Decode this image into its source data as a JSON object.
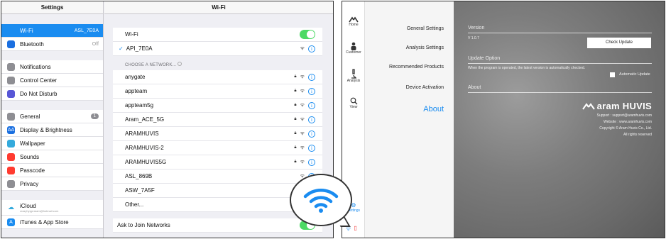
{
  "ipad": {
    "settings_title": "Settings",
    "wifi_title": "Wi-Fi",
    "settings_rows": [
      {
        "label": "Wi-Fi",
        "value": "ASL_7E0A",
        "icon": "wifi-icon",
        "color": "#1a8cf0",
        "selected": true
      },
      {
        "label": "Bluetooth",
        "value": "Off",
        "icon": "bluetooth-icon",
        "color": "#1a6fe0"
      }
    ],
    "settings_group2": [
      {
        "label": "Notifications",
        "icon": "notifications-icon",
        "color": "#8e8e93"
      },
      {
        "label": "Control Center",
        "icon": "control-center-icon",
        "color": "#8e8e93"
      },
      {
        "label": "Do Not Disturb",
        "icon": "moon-icon",
        "color": "#5856d6"
      }
    ],
    "settings_group3": [
      {
        "label": "General",
        "icon": "gear-icon",
        "color": "#8e8e93",
        "badge": "1"
      },
      {
        "label": "Display & Brightness",
        "icon": "display-icon",
        "color": "#1a6fe0",
        "glyph": "AA"
      },
      {
        "label": "Wallpaper",
        "icon": "wallpaper-icon",
        "color": "#34aadc"
      },
      {
        "label": "Sounds",
        "icon": "sounds-icon",
        "color": "#ff3b30"
      },
      {
        "label": "Passcode",
        "icon": "lock-icon",
        "color": "#ff3b30"
      },
      {
        "label": "Privacy",
        "icon": "hand-icon",
        "color": "#8e8e93"
      }
    ],
    "icloud": {
      "label": "iCloud",
      "sub": "crazyhyppraram@hotmail.com"
    },
    "itunes": {
      "label": "iTunes & App Store"
    },
    "wifi_label": "Wi-Fi",
    "connected_network": "API_7E0A",
    "choose_header": "CHOOSE A NETWORK...",
    "networks": [
      {
        "name": "anygate",
        "locked": true
      },
      {
        "name": "appteam",
        "locked": true
      },
      {
        "name": "appteam5g",
        "locked": true
      },
      {
        "name": "Aram_ACE_5G",
        "locked": true
      },
      {
        "name": "ARAMHUVIS",
        "locked": true
      },
      {
        "name": "ARAMHUVIS-2",
        "locked": true
      },
      {
        "name": "ARAMHUVIS5G",
        "locked": true
      },
      {
        "name": "ASL_869B",
        "locked": false
      },
      {
        "name": "ASW_7A5F",
        "locked": false
      },
      {
        "name": "Other...",
        "locked": false
      }
    ],
    "ask_join": "Ask to Join Networks"
  },
  "app": {
    "sidebar": [
      {
        "label": "Home",
        "icon": "home-logo-icon"
      },
      {
        "label": "Customer",
        "icon": "person-icon"
      },
      {
        "label": "Analysis",
        "icon": "microscope-icon"
      },
      {
        "label": "View",
        "icon": "magnifier-icon"
      },
      {
        "label": "Settings",
        "icon": "settings-icon"
      }
    ],
    "menu": [
      "General Settings",
      "Analysis Settings",
      "Recommended Products",
      "Device Activation"
    ],
    "menu_active": "About",
    "version_title": "Version",
    "version_value": "V 1.0.7",
    "check_update": "Check Update",
    "update_title": "Update Option",
    "update_desc": "When the program is operated, the latest version is automatically checked.",
    "auto_update": "Automatic Update",
    "about_title": "About",
    "brand": "aram HUVIS",
    "support": "Support : support@aramhuvis.com",
    "website": "Website : www.aramhuvis.com",
    "copyright": "Copyright © Aram Huvis Co., Ltd.",
    "rights": "All rights reserved"
  }
}
